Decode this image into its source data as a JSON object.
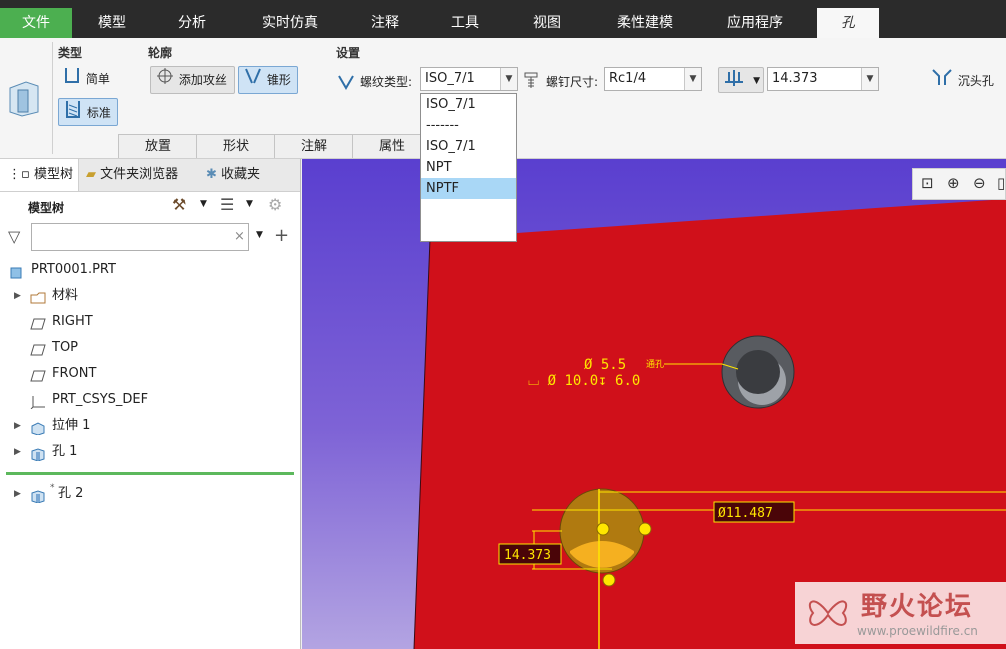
{
  "menubar": {
    "tabs": [
      "文件",
      "模型",
      "分析",
      "实时仿真",
      "注释",
      "工具",
      "视图",
      "柔性建模",
      "应用程序",
      "孔"
    ],
    "active_tab": "孔"
  },
  "ribbon": {
    "type_group": {
      "title": "类型",
      "simple": "简单",
      "standard": "标准"
    },
    "profile_group": {
      "title": "轮廓",
      "add_tap": "添加攻丝",
      "taper": "锥形"
    },
    "settings_group": {
      "title": "设置",
      "thread_type_label": "螺纹类型:",
      "thread_type_value": "ISO_7/1",
      "screw_size_label": "螺钉尺寸:",
      "screw_size_value": "Rc1/4",
      "depth_value": "14.373",
      "countersink": "沉头孔"
    },
    "subtabs": [
      "放置",
      "形状",
      "注解",
      "属性"
    ]
  },
  "dropdown": {
    "options": [
      "ISO_7/1",
      "-------",
      "ISO_7/1",
      "NPT",
      "NPTF"
    ],
    "highlighted": "NPTF"
  },
  "leftpanel": {
    "tabs": [
      "模型树",
      "文件夹浏览器",
      "收藏夹"
    ],
    "header": "模型树",
    "filter_placeholder": "",
    "tree": [
      {
        "label": "PRT0001.PRT"
      },
      {
        "label": "材料"
      },
      {
        "label": "RIGHT"
      },
      {
        "label": "TOP"
      },
      {
        "label": "FRONT"
      },
      {
        "label": "PRT_CSYS_DEF"
      },
      {
        "label": "拉伸 1"
      },
      {
        "label": "孔 1"
      },
      {
        "label": "孔 2"
      }
    ]
  },
  "viewport": {
    "anno_hole1_line1": "Ø 5.5",
    "anno_hole1_thru": "通孔",
    "anno_hole1_line2": "⌴ Ø 10.0↧ 6.0",
    "dim_diameter": "Ø11.487",
    "dim_depth": "14.373"
  },
  "watermark": {
    "title": "野火论坛",
    "url": "www.proewildfire.cn"
  },
  "colors": {
    "file_tab": "#4caf50",
    "part_red": "#d0101a",
    "viewport_purple": "#5a3fcf",
    "anno_yellow": "#ffe600",
    "highlight": "#a9d7f6"
  }
}
